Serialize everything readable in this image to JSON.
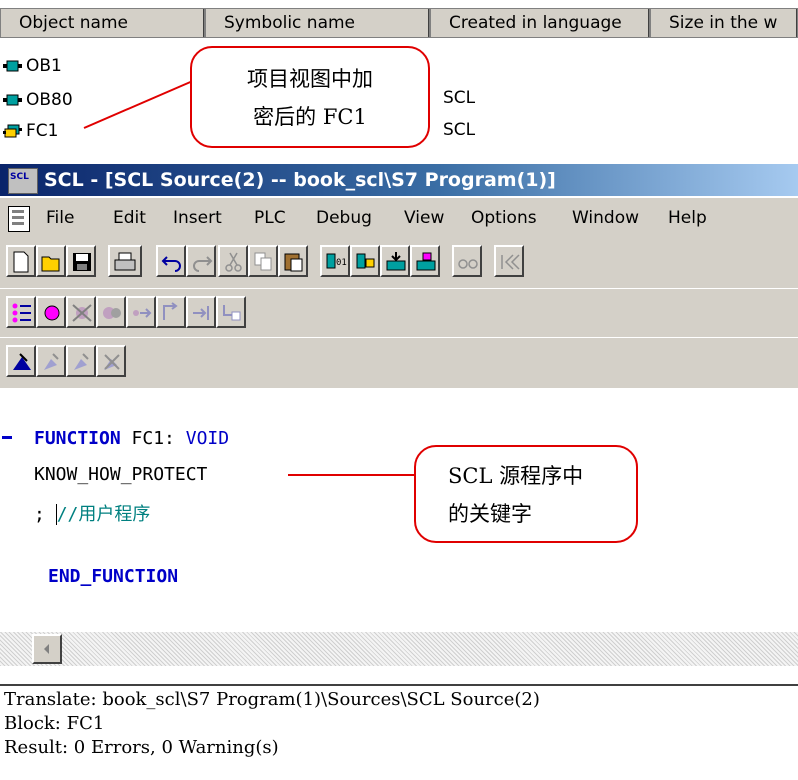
{
  "object_list": {
    "columns": [
      "Object name",
      "Symbolic name",
      "Created in language",
      "Size in the w"
    ],
    "rows": [
      {
        "name": "OB1",
        "language": ""
      },
      {
        "name": "OB80",
        "language": "SCL"
      },
      {
        "name": "FC1",
        "language": "SCL"
      }
    ]
  },
  "callouts": {
    "project_line1": "项目视图中加",
    "project_line2": "密后的 FC1",
    "scl_line1": "SCL 源程序中",
    "scl_line2": "的关键字"
  },
  "window": {
    "app_icon_text": "SCL",
    "title": "SCL  - [SCL Source(2) -- book_scl\\S7 Program(1)]"
  },
  "menu": [
    "File",
    "Edit",
    "Insert",
    "PLC",
    "Debug",
    "View",
    "Options",
    "Window",
    "Help"
  ],
  "editor": {
    "line1_keyword": "FUNCTION",
    "line1_name": " FC1:",
    "line1_type": " VOID",
    "line2": "KNOW_HOW_PROTECT",
    "line3_semicolon": ";",
    "line3_comment": "//用户程序",
    "line5_keyword": "END_FUNCTION"
  },
  "output": {
    "lines": [
      "Translate: book_scl\\S7 Program(1)\\Sources\\SCL Source(2)",
      "Block: FC1",
      "Result: 0 Errors, 0 Warning(s)"
    ]
  },
  "colors": {
    "keyword": "#0000c8",
    "comment": "#008080",
    "callout_border": "#e00000"
  }
}
